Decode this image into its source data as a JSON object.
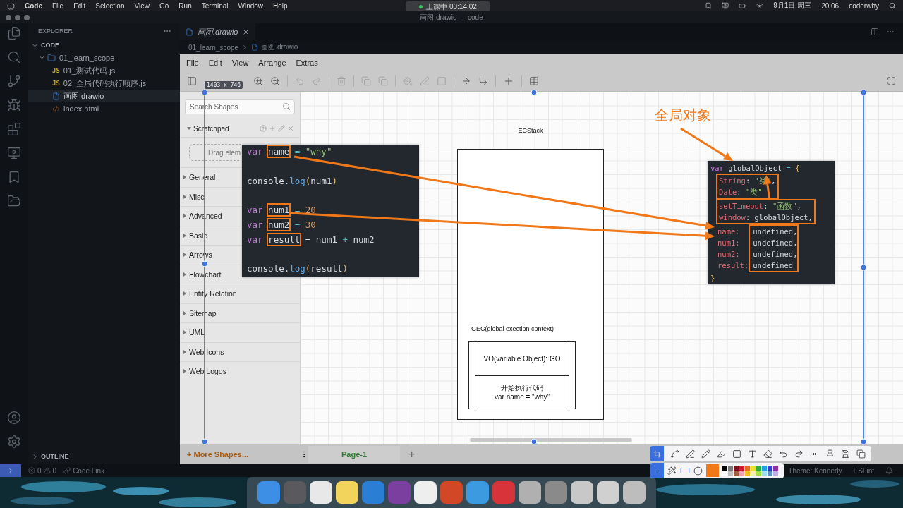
{
  "menubar": {
    "app": "Code",
    "items": [
      "File",
      "Edit",
      "Selection",
      "View",
      "Go",
      "Run",
      "Terminal",
      "Window",
      "Help"
    ],
    "recording": "上课中 00:14:02",
    "date": "9月1日 周三",
    "time": "20:06",
    "user": "coderwhy"
  },
  "window": {
    "title": "画图.drawio — code"
  },
  "explorer": {
    "title": "EXPLORER",
    "section": "CODE",
    "outline": "OUTLINE",
    "tree": [
      {
        "label": "01_learn_scope",
        "kind": "folder",
        "expanded": true,
        "selected": false,
        "children": [
          {
            "label": "01_测试代码.js",
            "kind": "js",
            "badge": "JS",
            "selected": false
          },
          {
            "label": "02_全局代码执行顺序.js",
            "kind": "js",
            "badge": "JS",
            "selected": false
          },
          {
            "label": "画图.drawio",
            "kind": "drawio",
            "selected": true
          },
          {
            "label": "index.html",
            "kind": "html",
            "selected": false
          }
        ]
      }
    ]
  },
  "editor": {
    "tabs": [
      {
        "label": "画图.drawio",
        "selected": true
      }
    ],
    "breadcrumb": [
      "01_learn_scope",
      "画图.drawio"
    ]
  },
  "drawio": {
    "menu": [
      "File",
      "Edit",
      "View",
      "Arrange",
      "Extras"
    ],
    "size_badge": "1403 x 746",
    "search": {
      "placeholder": "Search Shapes"
    },
    "scratchpad": {
      "title": "Scratchpad",
      "hint": "Drag elem"
    },
    "libraries": [
      "General",
      "Misc",
      "Advanced",
      "Basic",
      "Arrows",
      "Flowchart",
      "Entity Relation",
      "Sitemap",
      "UML",
      "Web Icons",
      "Web Logos"
    ],
    "more_shapes": "+ More Shapes...",
    "pages": [
      {
        "label": "Page-1",
        "selected": true
      }
    ],
    "add_page": "+"
  },
  "diagram": {
    "note": "全局对象",
    "stack": {
      "label": "ECStack",
      "context_label": "GEC(global exection context)",
      "rows": [
        {
          "lines": [
            "VO(variable Object): GO"
          ]
        },
        {
          "lines": [
            "开始执行代码",
            "var name = \"why\""
          ]
        }
      ]
    },
    "source_code": {
      "lines": [
        {
          "kind": "code",
          "tokens": [
            {
              "text": "var ",
              "kind": "keyword",
              "highlighted": false
            },
            {
              "text": "name",
              "kind": "plain",
              "highlighted": true
            },
            {
              "text": " = ",
              "kind": "op",
              "highlighted": false
            },
            {
              "text": "\"why\"",
              "kind": "string",
              "highlighted": false
            }
          ]
        },
        {
          "kind": "blank"
        },
        {
          "kind": "code",
          "tokens": [
            {
              "text": "console.",
              "kind": "plain",
              "highlighted": false
            },
            {
              "text": "log",
              "kind": "func",
              "highlighted": false
            },
            {
              "text": "(",
              "kind": "paren",
              "highlighted": false
            },
            {
              "text": "num1",
              "kind": "plain",
              "highlighted": false
            },
            {
              "text": ")",
              "kind": "paren",
              "highlighted": false
            }
          ]
        },
        {
          "kind": "blank"
        },
        {
          "kind": "code",
          "tokens": [
            {
              "text": "var ",
              "kind": "keyword",
              "highlighted": false
            },
            {
              "text": "num1",
              "kind": "plain",
              "highlighted": true
            },
            {
              "text": " = ",
              "kind": "op",
              "highlighted": false
            },
            {
              "text": "20",
              "kind": "number",
              "highlighted": false
            }
          ]
        },
        {
          "kind": "code",
          "tokens": [
            {
              "text": "var ",
              "kind": "keyword",
              "highlighted": false
            },
            {
              "text": "num2",
              "kind": "plain",
              "highlighted": true
            },
            {
              "text": " = ",
              "kind": "op",
              "highlighted": false
            },
            {
              "text": "30",
              "kind": "number",
              "highlighted": false
            }
          ]
        },
        {
          "kind": "code",
          "tokens": [
            {
              "text": "var ",
              "kind": "keyword",
              "highlighted": false
            },
            {
              "text": "result",
              "kind": "plain",
              "highlighted": true
            },
            {
              "text": " = num1 ",
              "kind": "plain",
              "highlighted": false
            },
            {
              "text": "+",
              "kind": "op",
              "highlighted": false
            },
            {
              "text": " num2",
              "kind": "plain",
              "highlighted": false
            }
          ]
        },
        {
          "kind": "blank"
        },
        {
          "kind": "code",
          "tokens": [
            {
              "text": "console.",
              "kind": "plain",
              "highlighted": false
            },
            {
              "text": "log",
              "kind": "func",
              "highlighted": false
            },
            {
              "text": "(",
              "kind": "paren",
              "highlighted": false
            },
            {
              "text": "result",
              "kind": "plain",
              "highlighted": false
            },
            {
              "text": ")",
              "kind": "paren",
              "highlighted": false
            }
          ]
        }
      ]
    },
    "global_object": {
      "open": [
        {
          "text": "var ",
          "kind": "keyword"
        },
        {
          "text": "globalObject",
          "kind": "plain"
        },
        {
          "text": " = ",
          "kind": "op"
        },
        {
          "text": "{",
          "kind": "paren"
        }
      ],
      "groups": [
        {
          "kind": "lines",
          "highlighted": true,
          "lines": [
            [
              {
                "text": "String",
                "kind": "prop"
              },
              {
                "text": ": ",
                "kind": "plain"
              },
              {
                "text": "\"类\"",
                "kind": "string"
              },
              {
                "text": ",",
                "kind": "plain"
              }
            ],
            [
              {
                "text": "Date",
                "kind": "prop"
              },
              {
                "text": ": ",
                "kind": "plain"
              },
              {
                "text": "\"类\"",
                "kind": "string"
              }
            ]
          ]
        },
        {
          "kind": "lines",
          "highlighted": true,
          "lines": [
            [
              {
                "text": "setTimeout",
                "kind": "prop"
              },
              {
                "text": ": ",
                "kind": "plain"
              },
              {
                "text": "\"函数\"",
                "kind": "string"
              },
              {
                "text": ",",
                "kind": "plain"
              }
            ],
            [
              {
                "text": "window",
                "kind": "prop"
              },
              {
                "text": ": globalObject,",
                "kind": "plain"
              }
            ]
          ]
        },
        {
          "kind": "pairs",
          "value_box": true,
          "pairs": [
            {
              "key": "name:",
              "value": "undefined,"
            },
            {
              "key": "num1:",
              "value": "undefined,"
            },
            {
              "key": "num2:",
              "value": "undefined,"
            },
            {
              "key": "result:",
              "value": "undefined"
            }
          ]
        }
      ],
      "close": [
        {
          "text": "}",
          "kind": "paren"
        }
      ]
    }
  },
  "status_bar": {
    "errors": "0",
    "warnings": "0",
    "code_link": "Code Link",
    "theme": "Theme: Kennedy",
    "lint": "ESLint"
  }
}
